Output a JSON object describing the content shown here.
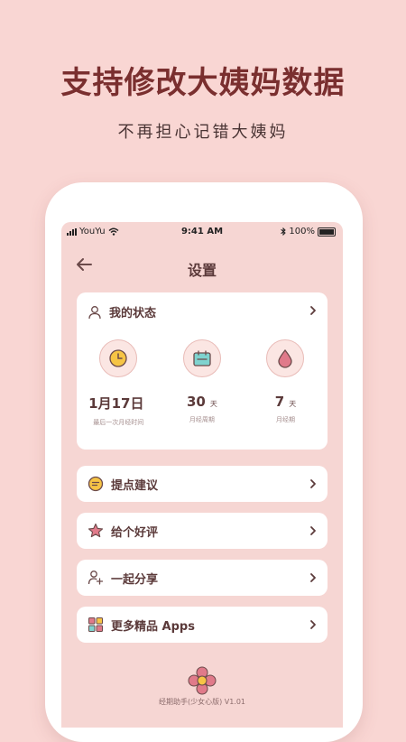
{
  "promo": {
    "headline": "支持修改大姨妈数据",
    "subline": "不再担心记错大姨妈"
  },
  "statusbar": {
    "carrier": "YouYu",
    "time": "9:41 AM",
    "battery": "100%"
  },
  "nav": {
    "title": "设置",
    "back_icon": "back-arrow-icon"
  },
  "status_card": {
    "title": "我的状态",
    "stats": [
      {
        "value": "1月17日",
        "unit": "",
        "label": "最后一次月经时间",
        "icon": "clock-icon"
      },
      {
        "value": "30",
        "unit": "天",
        "label": "月经周期",
        "icon": "calendar-icon"
      },
      {
        "value": "7",
        "unit": "天",
        "label": "月经期",
        "icon": "drop-icon"
      }
    ]
  },
  "menu": [
    {
      "label": "提点建议",
      "icon": "message-icon"
    },
    {
      "label": "给个好评",
      "icon": "star-icon"
    },
    {
      "label": "一起分享",
      "icon": "share-user-icon"
    },
    {
      "label": "更多精品 Apps",
      "icon": "apps-grid-icon"
    }
  ],
  "footer": {
    "version": "经期助手(少女心版) V1.01"
  },
  "colors": {
    "background": "#f9d6d3",
    "headline": "#7a2f2f",
    "screen": "#f6d6d3",
    "accent": "#e07a8a"
  }
}
